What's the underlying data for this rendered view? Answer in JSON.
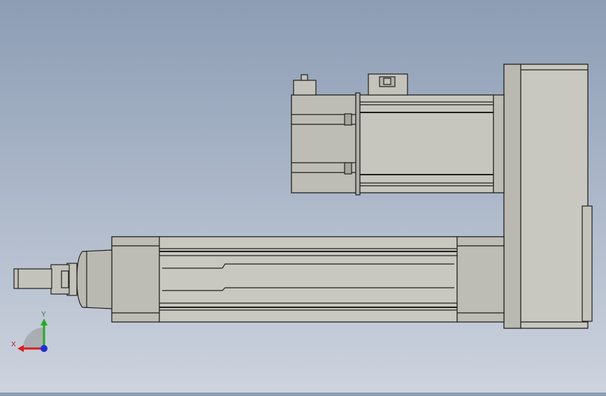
{
  "triad": {
    "x_label": "X",
    "y_label": "Y",
    "x_color": "#d81e1e",
    "y_color": "#1fae1f",
    "z_color": "#1e2fd8"
  },
  "model": {
    "fill_color": "#c3c3bb",
    "edge_color": "#1e1e1e",
    "shade_color": "#a5a59d"
  }
}
